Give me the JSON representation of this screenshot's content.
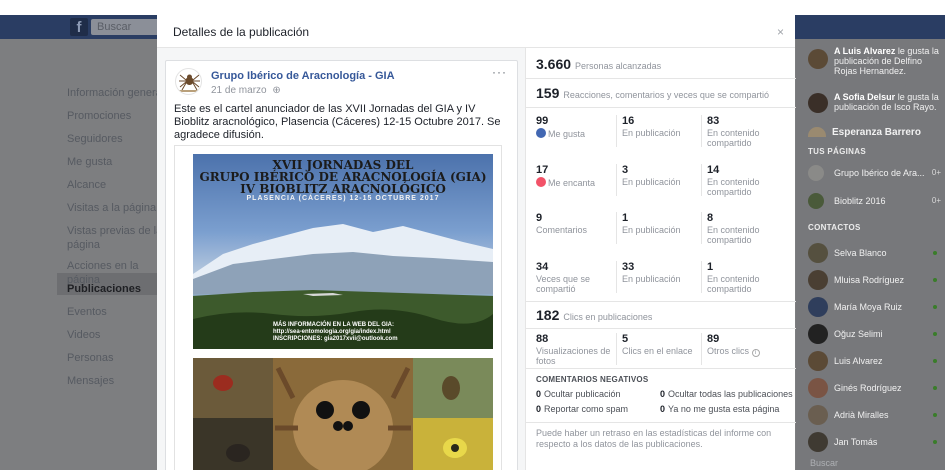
{
  "topbar": {
    "logo_letter": "f",
    "search_placeholder": "Buscar"
  },
  "left_nav": [
    {
      "label": "Información general"
    },
    {
      "label": "Promociones"
    },
    {
      "label": "Seguidores"
    },
    {
      "label": "Me gusta"
    },
    {
      "label": "Alcance"
    },
    {
      "label": "Visitas a la página"
    },
    {
      "label": "Vistas previas de la página"
    },
    {
      "label": "Acciones en la página"
    },
    {
      "label": "Publicaciones"
    },
    {
      "label": "Eventos"
    },
    {
      "label": "Videos"
    },
    {
      "label": "Personas"
    },
    {
      "label": "Mensajes"
    }
  ],
  "modal": {
    "title": "Detalles de la publicación",
    "close_label": "×"
  },
  "post": {
    "author": "Grupo Ibérico de Aracnología - GIA",
    "date": "21 de marzo",
    "more": "···",
    "text": "Este es el cartel anunciador de las XVII Jornadas del GIA y IV Bioblitz aracnológico, Plasencia (Cáceres) 12-15 Octubre 2017. Se agradece difusión.",
    "poster": {
      "line1": "XVII JORNADAS DEL",
      "line2": "GRUPO IBÉRICO DE ARACNOLOGÍA (GIA)",
      "line3": "IV BIOBLITZ ARACNOLÓGICO",
      "line4": "PLASENCIA (CÁCERES) 12-15 OCTUBRE 2017",
      "info1": "MÁS INFORMACIÓN EN LA WEB DEL GIA:",
      "info2": "http://sea-entomologia.org/gia/index.html",
      "info3": "INSCRIPCIONES: gia2017xvii@outlook.com"
    }
  },
  "stats": {
    "reach_num": "3.660",
    "reach_label": "Personas alcanzadas",
    "reactions_num": "159",
    "reactions_label": "Reacciones, comentarios y veces que se compartió",
    "rows": [
      {
        "a_num": "99",
        "a_label": "Me gusta",
        "b_num": "16",
        "b_label": "En publicación",
        "c_num": "83",
        "c_label": "En contenido compartido"
      },
      {
        "a_num": "17",
        "a_label": "Me encanta",
        "b_num": "3",
        "b_label": "En publicación",
        "c_num": "14",
        "c_label": "En contenido compartido"
      },
      {
        "a_num": "9",
        "a_label": "Comentarios",
        "b_num": "1",
        "b_label": "En publicación",
        "c_num": "8",
        "c_label": "En contenido compartido"
      },
      {
        "a_num": "34",
        "a_label": "Veces que se compartió",
        "b_num": "33",
        "b_label": "En publicación",
        "c_num": "1",
        "c_label": "En contenido compartido"
      }
    ],
    "clicks_num": "182",
    "clicks_label": "Clics en publicaciones",
    "clicks": [
      {
        "num": "88",
        "label": "Visualizaciones de fotos"
      },
      {
        "num": "5",
        "label": "Clics en el enlace"
      },
      {
        "num": "89",
        "label": "Otros clics"
      }
    ],
    "negative_title": "COMENTARIOS NEGATIVOS",
    "negative": [
      {
        "num": "0",
        "label": "Ocultar publicación"
      },
      {
        "num": "0",
        "label": "Ocultar todas las publicaciones"
      },
      {
        "num": "0",
        "label": "Reportar como spam"
      },
      {
        "num": "0",
        "label": "Ya no me gusta esta página"
      }
    ],
    "footnote": "Puede haber un retraso en las estadísticas del informe con respecto a los datos de las publicaciones."
  },
  "right_sidebar": {
    "notif1_bold": "A Luis Alvarez",
    "notif1_rest": " le gusta la publicación de Delfino Rojas Hernandez.",
    "notif2_bold": "A Sofia Delsur",
    "notif2_rest": " le gusta la publicación de Isco Rayo.",
    "partial_name": "Esperanza Barrero",
    "pages_title": "TUS PÁGINAS",
    "pages": [
      {
        "name": "Grupo Ibérico de Ara..."
      },
      {
        "name": "Bioblitz 2016"
      }
    ],
    "contacts_title": "CONTACTOS",
    "contacts": [
      {
        "name": "Selva Blanco"
      },
      {
        "name": "Mluisa Rodríguez"
      },
      {
        "name": "María Moya Ruiz"
      },
      {
        "name": "Oğuz Selimi"
      },
      {
        "name": "Luis Alvarez"
      },
      {
        "name": "Ginés Rodríguez"
      },
      {
        "name": "Adrià Miralles"
      },
      {
        "name": "Jan Tomás"
      }
    ],
    "search_placeholder": "Buscar"
  }
}
